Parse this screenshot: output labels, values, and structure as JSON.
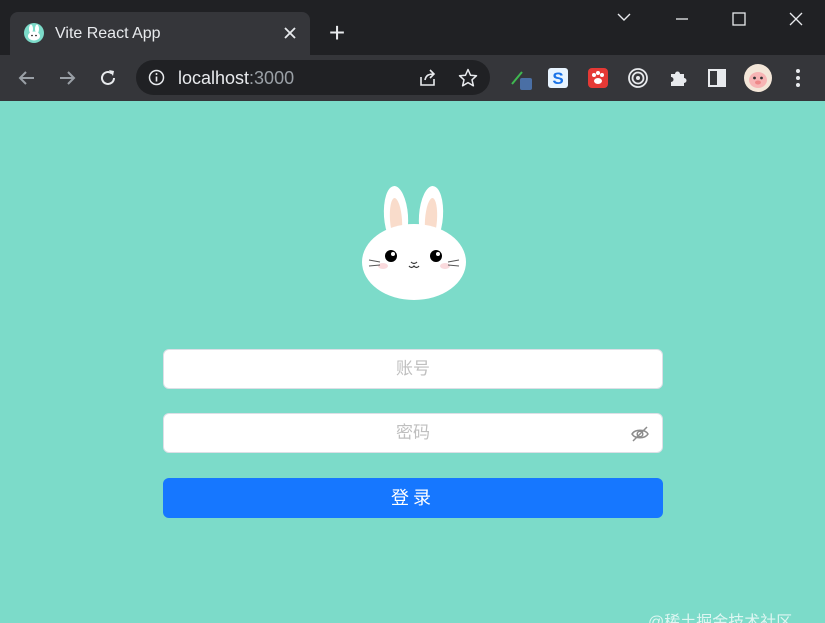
{
  "browser": {
    "tab_title": "Vite React App",
    "new_tab_label": "+",
    "url_host": "localhost",
    "url_port": ":3000"
  },
  "icons": {
    "back": "back-arrow-icon",
    "forward": "forward-arrow-icon",
    "reload": "reload-icon",
    "info": "info-icon",
    "share": "share-icon",
    "bookmark": "star-icon",
    "extensions": [
      "color-picker-extension-icon",
      "s-extension-icon",
      "paw-extension-icon",
      "target-extension-icon",
      "puzzle-icon",
      "sidepanel-icon"
    ],
    "profile": "profile-avatar",
    "menu": "kebab-menu-icon",
    "eye": "eye-off-icon"
  },
  "login": {
    "account_placeholder": "账号",
    "password_placeholder": "密码",
    "submit_label": "登录"
  },
  "watermark": "@稀土掘金技术社区",
  "colors": {
    "page_bg": "#7cdbc9",
    "primary": "#1677ff",
    "chrome_dark": "#202124",
    "chrome_mid": "#35363a"
  }
}
